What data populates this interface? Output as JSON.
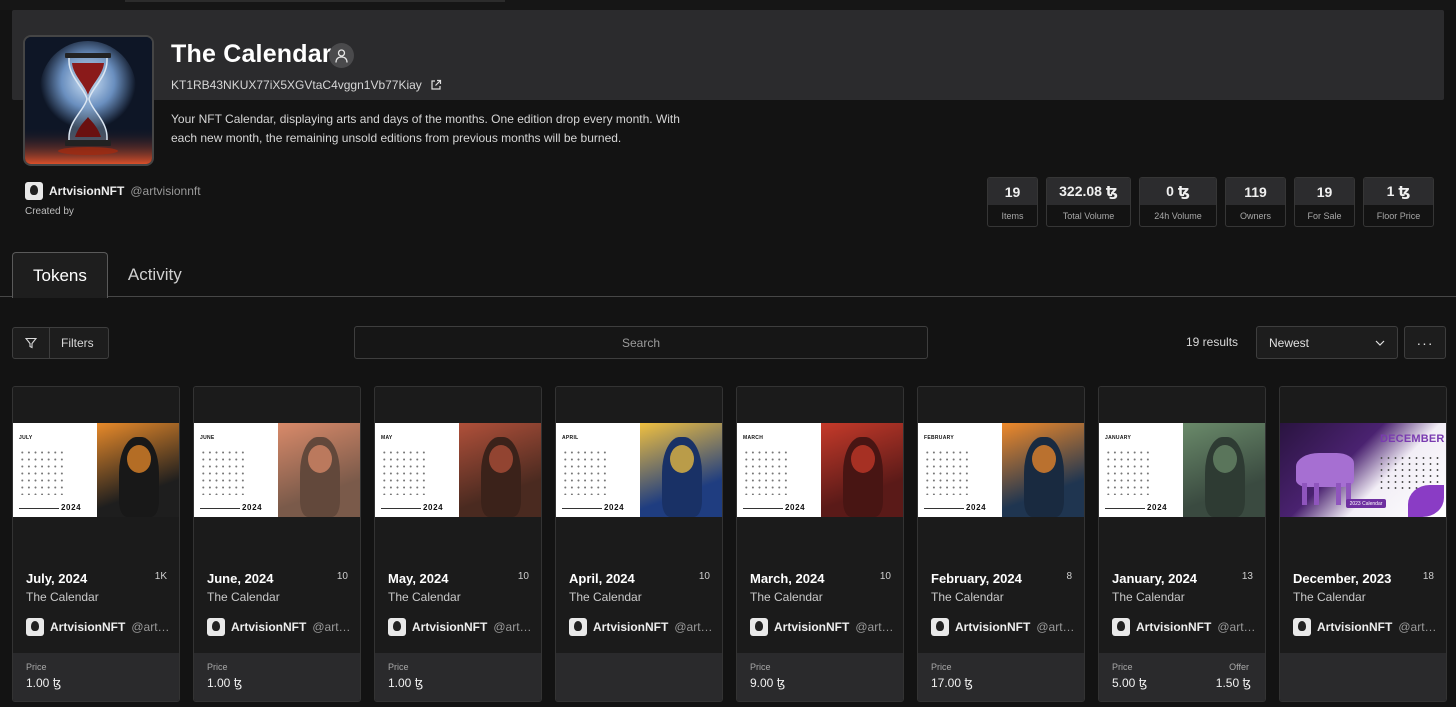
{
  "collection": {
    "title": "The Calendar",
    "contract": "KT1RB43NKUX77iX5XGVtaC4vggn1Vb77Kiay",
    "description": "Your NFT Calendar, displaying arts and days of the months. One edition drop every month. With each new month, the remaining unsold editions from previous months will be burned.",
    "creator_name": "ArtvisionNFT",
    "creator_handle": "@artvisionnft",
    "created_by_label": "Created by"
  },
  "stats": [
    {
      "value": "19",
      "label": "Items"
    },
    {
      "value": "322.08 ꜩ",
      "label": "Total Volume"
    },
    {
      "value": "0 ꜩ",
      "label": "24h Volume"
    },
    {
      "value": "119",
      "label": "Owners"
    },
    {
      "value": "19",
      "label": "For Sale"
    },
    {
      "value": "1 ꜩ",
      "label": "Floor Price"
    }
  ],
  "tabs": {
    "tokens": "Tokens",
    "activity": "Activity"
  },
  "toolbar": {
    "filters_label": "Filters",
    "search_placeholder": "Search",
    "results": "19 results",
    "sort": "Newest",
    "more": "···"
  },
  "tokens": [
    {
      "name": "July, 2024",
      "count": "1K",
      "collection": "The Calendar",
      "owner": "ArtvisionNFT",
      "handle": "@artvisionnft",
      "price_label": "Price",
      "price": "1.00 ꜩ",
      "offer_label": "",
      "offer": "",
      "month_label": "JULY",
      "year": "2024",
      "accent": "#e88a2a",
      "art_color": "#1e1e1e"
    },
    {
      "name": "June, 2024",
      "count": "10",
      "collection": "The Calendar",
      "owner": "ArtvisionNFT",
      "handle": "@artvisionnft",
      "price_label": "Price",
      "price": "1.00 ꜩ",
      "offer_label": "",
      "offer": "",
      "month_label": "JUNE",
      "year": "2024",
      "accent": "#d98a6a",
      "art_color": "#7a5a4a"
    },
    {
      "name": "May, 2024",
      "count": "10",
      "collection": "The Calendar",
      "owner": "ArtvisionNFT",
      "handle": "@artvisionnft",
      "price_label": "Price",
      "price": "1.00 ꜩ",
      "offer_label": "",
      "offer": "",
      "month_label": "MAY",
      "year": "2024",
      "accent": "#b0503a",
      "art_color": "#4a2a20"
    },
    {
      "name": "April, 2024",
      "count": "10",
      "collection": "The Calendar",
      "owner": "ArtvisionNFT",
      "handle": "@artvisionnft",
      "price_label": "",
      "price": "",
      "offer_label": "",
      "offer": "",
      "month_label": "APRIL",
      "year": "2024",
      "accent": "#f0c040",
      "art_color": "#1f3d80"
    },
    {
      "name": "March, 2024",
      "count": "10",
      "collection": "The Calendar",
      "owner": "ArtvisionNFT",
      "handle": "@artvisionnft",
      "price_label": "Price",
      "price": "9.00 ꜩ",
      "offer_label": "",
      "offer": "",
      "month_label": "MARCH",
      "year": "2024",
      "accent": "#c53a2a",
      "art_color": "#5a1a18"
    },
    {
      "name": "February, 2024",
      "count": "8",
      "collection": "The Calendar",
      "owner": "ArtvisionNFT",
      "handle": "@artvisionnft",
      "price_label": "Price",
      "price": "17.00 ꜩ",
      "offer_label": "",
      "offer": "",
      "month_label": "FEBRUARY",
      "year": "2024",
      "accent": "#f08a2a",
      "art_color": "#1f3550"
    },
    {
      "name": "January, 2024",
      "count": "13",
      "collection": "The Calendar",
      "owner": "ArtvisionNFT",
      "handle": "@artvisionnft",
      "price_label": "Price",
      "price": "5.00 ꜩ",
      "offer_label": "Offer",
      "offer": "1.50 ꜩ",
      "month_label": "JANUARY",
      "year": "2024",
      "accent": "#6a8a6a",
      "art_color": "#3a4a40"
    },
    {
      "name": "December, 2023",
      "count": "18",
      "collection": "The Calendar",
      "owner": "ArtvisionNFT",
      "handle": "@artvisionnft",
      "price_label": "",
      "price": "",
      "offer_label": "",
      "offer": "",
      "month_label": "DECEMBER",
      "year": "2023 Calendar",
      "accent": "#7a3bb0",
      "art_color": "#4a2270"
    }
  ]
}
